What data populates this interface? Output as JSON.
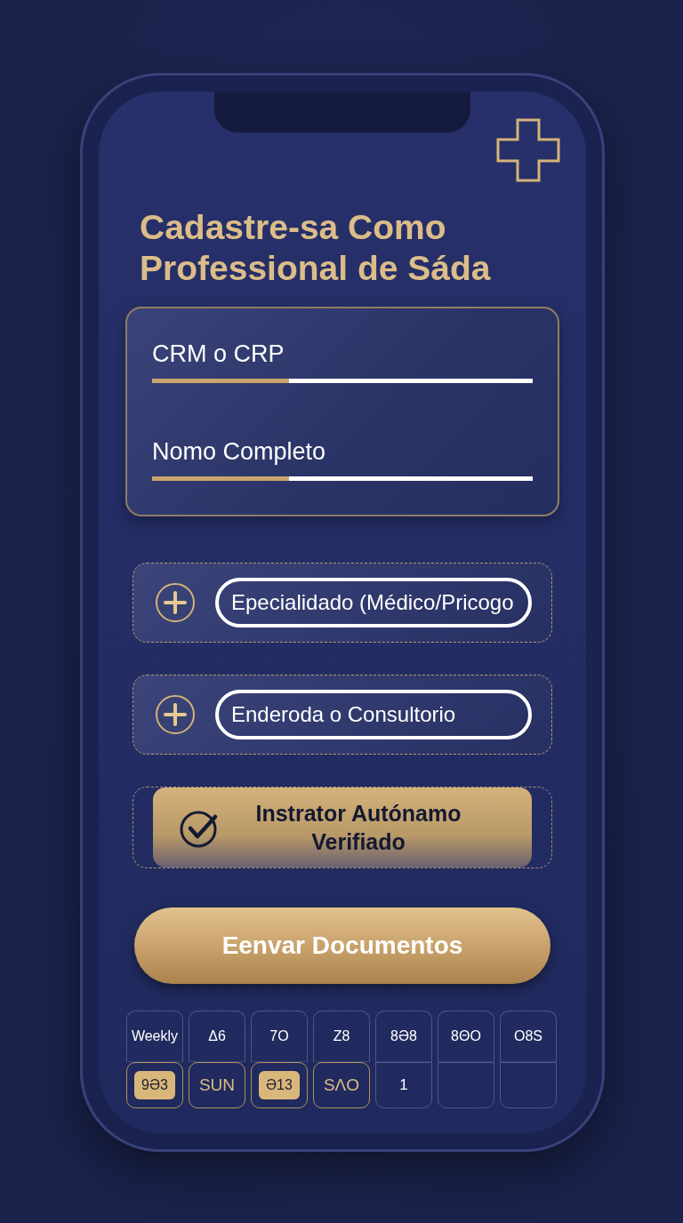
{
  "title": "Cadastre-sa Como Professional de Sáda",
  "fields": [
    {
      "label": "CRM o CRP",
      "level": 0.36
    },
    {
      "label": "Nomo Completo",
      "level": 0.36
    }
  ],
  "add_rows": [
    {
      "label": "Epecialidado (Médico/Pricogo"
    },
    {
      "label": "Enderoda o Consultorio"
    }
  ],
  "verified": {
    "label": "Instrator Autónamo Verifiado",
    "checked": true
  },
  "submit_button": "Eenvar Documentos",
  "schedule": {
    "header": [
      "Weekly",
      "Δ6",
      "7O",
      "Z8",
      "8Ə8",
      "8ΘO",
      "O8S"
    ],
    "cells": [
      {
        "text": "9Ə3",
        "kind": "badge",
        "selected": true
      },
      {
        "text": "SUN",
        "kind": "gold",
        "selected": true
      },
      {
        "text": "Ə13",
        "kind": "badge",
        "selected": true
      },
      {
        "text": "SΛO",
        "kind": "gold",
        "selected": true
      },
      {
        "text": "1",
        "kind": "plain",
        "selected": false
      },
      {
        "selected": false
      },
      {
        "selected": false
      }
    ]
  }
}
